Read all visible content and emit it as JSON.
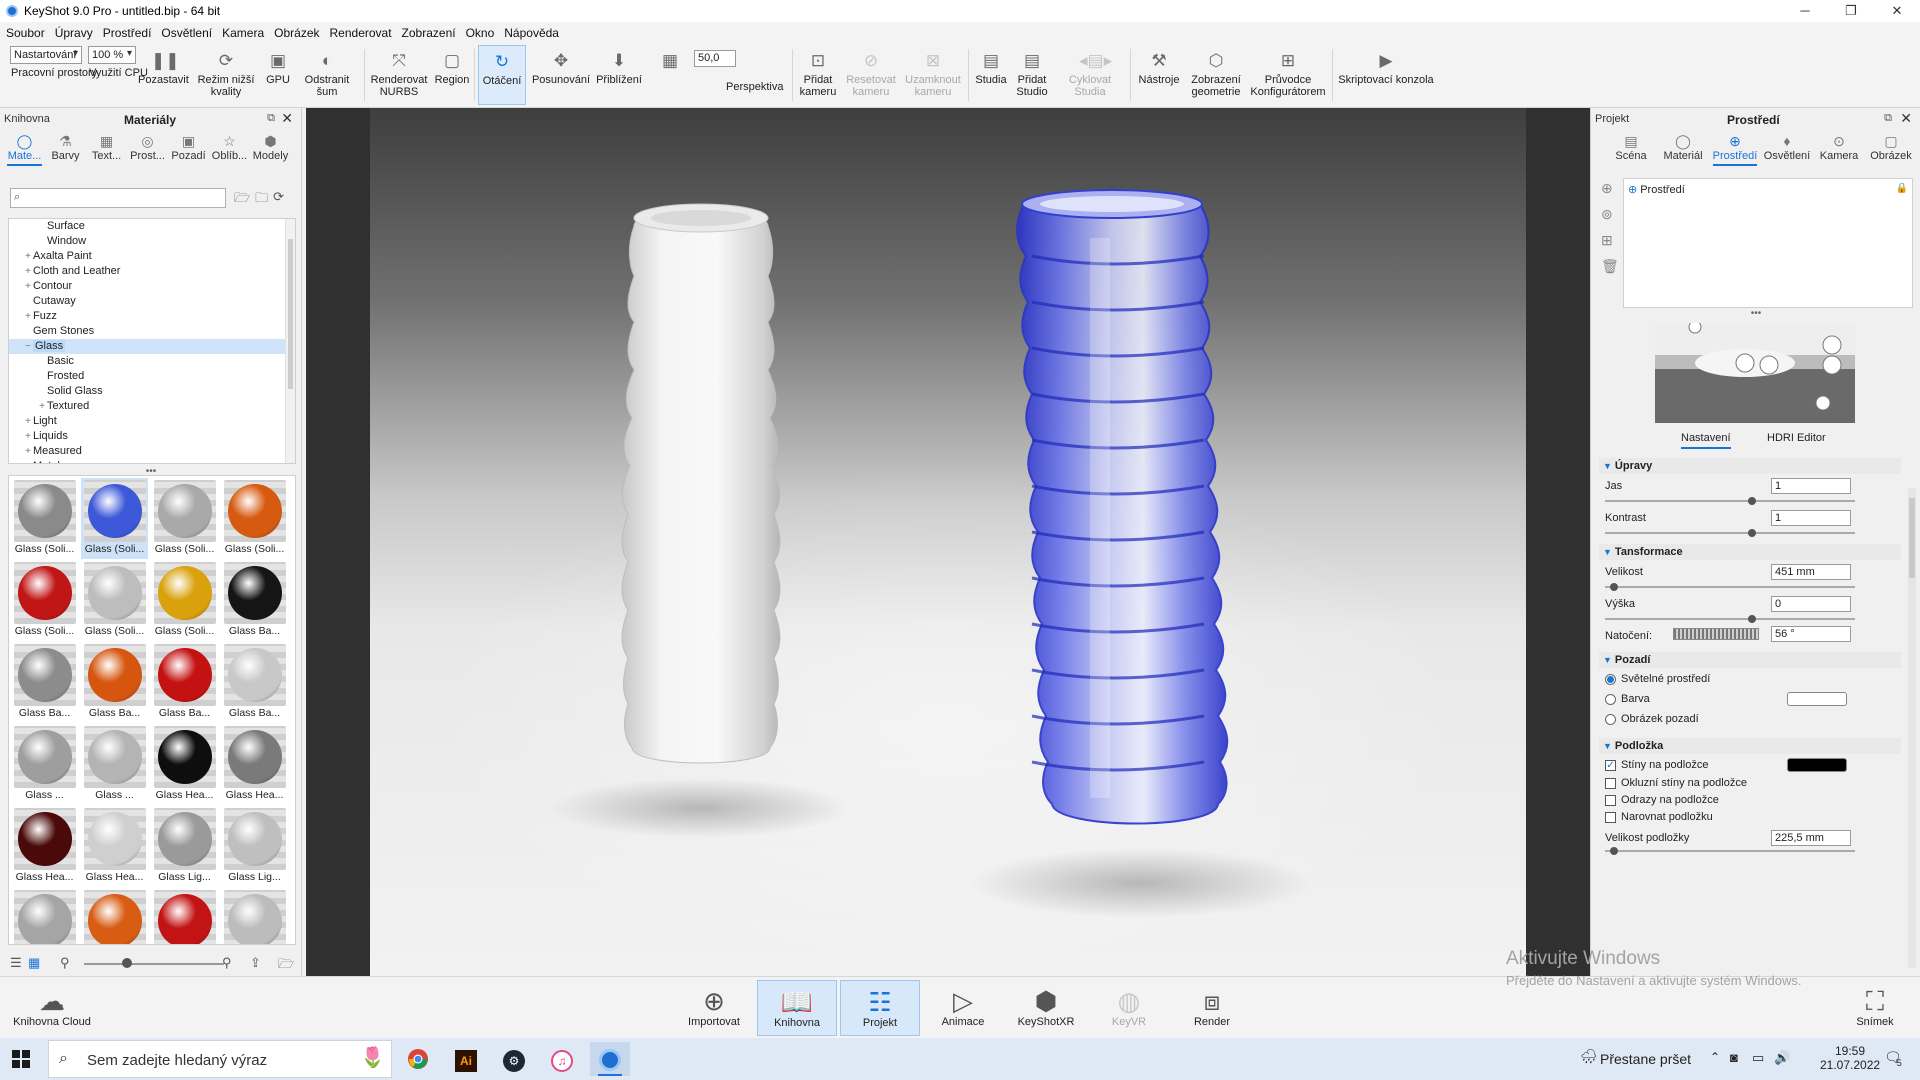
{
  "window": {
    "title": "KeyShot 9.0 Pro  - untitled.bip  - 64 bit",
    "controls": [
      "─",
      "❐",
      "✕"
    ]
  },
  "menu": [
    "Soubor",
    "Úpravy",
    "Prostředí",
    "Osvětlení",
    "Kamera",
    "Obrázek",
    "Renderovat",
    "Zobrazení",
    "Okno",
    "Nápověda"
  ],
  "toolbar": {
    "workspace_select": "Nastartování",
    "zoom_select": "100 %",
    "workspace_label": "Pracovní prostory",
    "cpu_label": "Využití CPU",
    "pause": "Pozastavit",
    "low_quality": "Režim nižší kvality",
    "gpu": "GPU",
    "denoise": "Odstranit šum",
    "nurbs_line1": "Renderovat",
    "nurbs_line2": "NURBS",
    "region": "Region",
    "rotate": "Otáčení",
    "pan": "Posunování",
    "dolly": "Přiblížení",
    "fov_value": "50,0",
    "perspective": "Perspektiva",
    "add_camera_1": "Přidat",
    "add_camera_2": "kameru",
    "reset_camera_1": "Resetovat",
    "reset_camera_2": "kameru",
    "lock_camera_1": "Uzamknout",
    "lock_camera_2": "kameru",
    "studios": "Studia",
    "add_studio_1": "Přidat",
    "add_studio_2": "Studio",
    "cycle_studios_1": "Cyklovat",
    "cycle_studios_2": "Studia",
    "tools": "Nástroje",
    "geometry_1": "Zobrazení",
    "geometry_2": "geometrie",
    "configurator_1": "Průvodce",
    "configurator_2": "Konfigurátorem",
    "script_console": "Skriptovací konzola"
  },
  "left_panel": {
    "tab_library": "Knihovna",
    "title": "Materiály",
    "tabs": [
      {
        "label": "Mate...",
        "icon": "material-icon"
      },
      {
        "label": "Barvy",
        "icon": "color-icon"
      },
      {
        "label": "Text...",
        "icon": "texture-icon"
      },
      {
        "label": "Prost...",
        "icon": "environment-icon"
      },
      {
        "label": "Pozadí",
        "icon": "background-icon"
      },
      {
        "label": "Oblíb...",
        "icon": "favorites-icon"
      },
      {
        "label": "Modely",
        "icon": "models-icon"
      }
    ],
    "search_placeholder": "",
    "tree": [
      {
        "label": "Surface",
        "level": 2,
        "toggle": ""
      },
      {
        "label": "Window",
        "level": 2,
        "toggle": ""
      },
      {
        "label": "Axalta Paint",
        "level": 1,
        "toggle": "+"
      },
      {
        "label": "Cloth and Leather",
        "level": 1,
        "toggle": "+"
      },
      {
        "label": "Contour",
        "level": 1,
        "toggle": "+"
      },
      {
        "label": "Cutaway",
        "level": 1,
        "toggle": ""
      },
      {
        "label": "Fuzz",
        "level": 1,
        "toggle": "+"
      },
      {
        "label": "Gem Stones",
        "level": 1,
        "toggle": ""
      },
      {
        "label": "Glass",
        "level": 1,
        "toggle": "−",
        "selected": true
      },
      {
        "label": "Basic",
        "level": 2,
        "toggle": ""
      },
      {
        "label": "Frosted",
        "level": 2,
        "toggle": ""
      },
      {
        "label": "Solid Glass",
        "level": 2,
        "toggle": ""
      },
      {
        "label": "Textured",
        "level": 2,
        "toggle": "+"
      },
      {
        "label": "Light",
        "level": 1,
        "toggle": "+"
      },
      {
        "label": "Liquids",
        "level": 1,
        "toggle": "+"
      },
      {
        "label": "Measured",
        "level": 1,
        "toggle": "+"
      },
      {
        "label": "Metal",
        "level": 1,
        "toggle": "+"
      }
    ],
    "thumbnails": [
      {
        "caption": "Glass (Soli...",
        "color": "#8a8a8a"
      },
      {
        "caption": "Glass (Soli...",
        "color": "#3d58d8",
        "selected": true
      },
      {
        "caption": "Glass (Soli...",
        "color": "#a9a9a9"
      },
      {
        "caption": "Glass (Soli...",
        "color": "#d65a10"
      },
      {
        "caption": "Glass (Soli...",
        "color": "#c01616"
      },
      {
        "caption": "Glass (Soli...",
        "color": "#bdbdbd"
      },
      {
        "caption": "Glass (Soli...",
        "color": "#d9a10c"
      },
      {
        "caption": "Glass Ba...",
        "color": "#151515"
      },
      {
        "caption": "Glass Ba...",
        "color": "#8c8c8c"
      },
      {
        "caption": "Glass Ba...",
        "color": "#d6560f"
      },
      {
        "caption": "Glass Ba...",
        "color": "#c41212"
      },
      {
        "caption": "Glass Ba...",
        "color": "#c8c8c8"
      },
      {
        "caption": "Glass ...",
        "color": "#9e9e9e"
      },
      {
        "caption": "Glass ...",
        "color": "#b4b4b4"
      },
      {
        "caption": "Glass Hea...",
        "color": "#0e0e0e"
      },
      {
        "caption": "Glass Hea...",
        "color": "#7a7a7a"
      },
      {
        "caption": "Glass Hea...",
        "color": "#4b0a0a"
      },
      {
        "caption": "Glass Hea...",
        "color": "#cfcfcf"
      },
      {
        "caption": "Glass Lig...",
        "color": "#9a9a9a"
      },
      {
        "caption": "Glass Lig...",
        "color": "#bfbfbf"
      },
      {
        "caption": "",
        "color": "#a5a5a5"
      },
      {
        "caption": "",
        "color": "#d85c12"
      },
      {
        "caption": "",
        "color": "#c21414"
      },
      {
        "caption": "",
        "color": "#bcbcbc"
      }
    ]
  },
  "right_panel": {
    "tab_project": "Projekt",
    "title": "Prostředí",
    "tabs": [
      {
        "label": "Scéna",
        "icon": "scene-icon"
      },
      {
        "label": "Materiál",
        "icon": "material-icon"
      },
      {
        "label": "Prostředí",
        "icon": "environment-icon",
        "active": true
      },
      {
        "label": "Osvětlení",
        "icon": "lighting-icon"
      },
      {
        "label": "Kamera",
        "icon": "camera-icon"
      },
      {
        "label": "Obrázek",
        "icon": "image-icon"
      }
    ],
    "env_item": "Prostředí",
    "sub_tabs": {
      "settings": "Nastavení",
      "hdri_editor": "HDRI Editor"
    },
    "sections": {
      "adjustments": "Úpravy",
      "transform": "Tansformace",
      "background": "Pozadí",
      "ground": "Podložka"
    },
    "brightness": {
      "label": "Jas",
      "value": "1",
      "level": 0.58
    },
    "contrast": {
      "label": "Kontrast",
      "value": "1",
      "level": 0.58
    },
    "size": {
      "label": "Velikost",
      "value": "451 mm",
      "level": 0.02
    },
    "height": {
      "label": "Výška",
      "value": "0",
      "level": 0.58
    },
    "rotation": {
      "label": "Natočení:",
      "value": "56 °"
    },
    "bg_options": [
      {
        "label": "Světelné prostředí",
        "checked": true
      },
      {
        "label": "Barva",
        "checked": false
      },
      {
        "label": "Obrázek pozadí",
        "checked": false
      }
    ],
    "bg_color": "#ffffff",
    "ground_options": [
      {
        "label": "Stíny na podložce",
        "checked": true
      },
      {
        "label": "Okluzní stíny na podložce",
        "checked": false
      },
      {
        "label": "Odrazy na podložce",
        "checked": false
      },
      {
        "label": "Narovnat podložku",
        "checked": false
      }
    ],
    "shadow_color": "#000000",
    "ground_size": {
      "label": "Velikost podložky",
      "value": "225,5 mm",
      "level": 0.02
    }
  },
  "bottom": {
    "cloud": "Knihovna Cloud",
    "import": "Importovat",
    "library": "Knihovna",
    "project": "Projekt",
    "animation": "Animace",
    "keyshotxr": "KeyShotXR",
    "keyvr": "KeyVR",
    "render": "Render",
    "screenshot": "Snímek",
    "watermark_title": "Aktivujte Windows",
    "watermark_sub": "Přejděte do Nastavení a aktivujte systém Windows."
  },
  "taskbar": {
    "search_placeholder": "Sem zadejte hledaný výraz",
    "weather": "Přestane pršet",
    "time": "19:59",
    "date": "21.07.2022",
    "notifications": "5"
  },
  "colors": {
    "accent": "#1a73d8",
    "white_vase": "#efefef",
    "blue_vase": "#3b46d6"
  }
}
